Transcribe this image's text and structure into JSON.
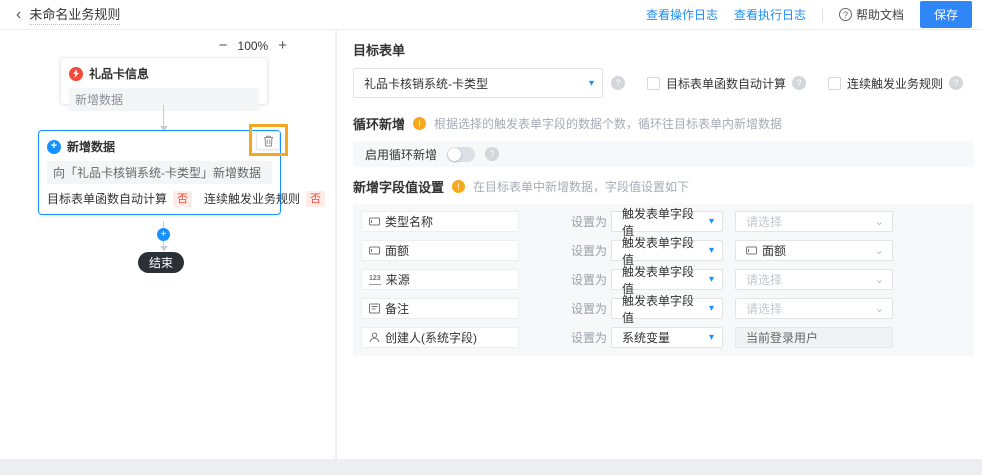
{
  "header": {
    "back_icon": "‹",
    "title": "未命名业务规则",
    "link_operation_log": "查看操作日志",
    "link_execution_log": "查看执行日志",
    "help_icon": "?",
    "help_doc": "帮助文档",
    "save_label": "保存"
  },
  "canvas": {
    "zoom_out": "−",
    "zoom_level": "100%",
    "zoom_in": "+",
    "trigger_node": {
      "title": "礼品卡信息",
      "body": "新增数据"
    },
    "action_node": {
      "plus_icon": "+",
      "title": "新增数据",
      "target_line": "向「礼品卡核销系统-卡类型」新增数据",
      "flag1_label": "目标表单函数自动计算",
      "flag1_value": "否",
      "flag2_label": "连续触发业务规则",
      "flag2_value": "否"
    },
    "connector_plus": "+",
    "end_node": "结束"
  },
  "panel": {
    "target_form": {
      "label": "目标表单",
      "value": "礼品卡核销系统-卡类型",
      "info_icon": "?",
      "checkbox1": "目标表单函数自动计算",
      "checkbox2": "连续触发业务规则"
    },
    "loop_section": {
      "title": "循环新增",
      "warn_icon": "!",
      "hint": "根据选择的触发表单字段的数据个数，循环往目标表单内新增数据",
      "toggle_label": "启用循环新增",
      "info_icon": "?"
    },
    "fields_section": {
      "title": "新增字段值设置",
      "warn_icon": "!",
      "hint": "在目标表单中新增数据，字段值设置如下",
      "set_as_label": "设置为",
      "number_icon_text": "123",
      "rows": [
        {
          "field": "类型名称",
          "mode": "触发表单字段值",
          "value": "请选择"
        },
        {
          "field": "面额",
          "mode": "触发表单字段值",
          "value": "面额"
        },
        {
          "field": "来源",
          "mode": "触发表单字段值",
          "value": "请选择"
        },
        {
          "field": "备注",
          "mode": "触发表单字段值",
          "value": "请选择"
        },
        {
          "field": "创建人(系统字段)",
          "mode": "系统变量",
          "value": "当前登录用户"
        }
      ]
    }
  },
  "icons": {
    "caret_down_filled": "▾",
    "chevron_down": "⌄"
  },
  "colors": {
    "accent_blue": "#1890ff",
    "danger_red": "#f5483b",
    "annotation_orange": "#f5a623",
    "end_node_dark": "#2b2f36"
  }
}
